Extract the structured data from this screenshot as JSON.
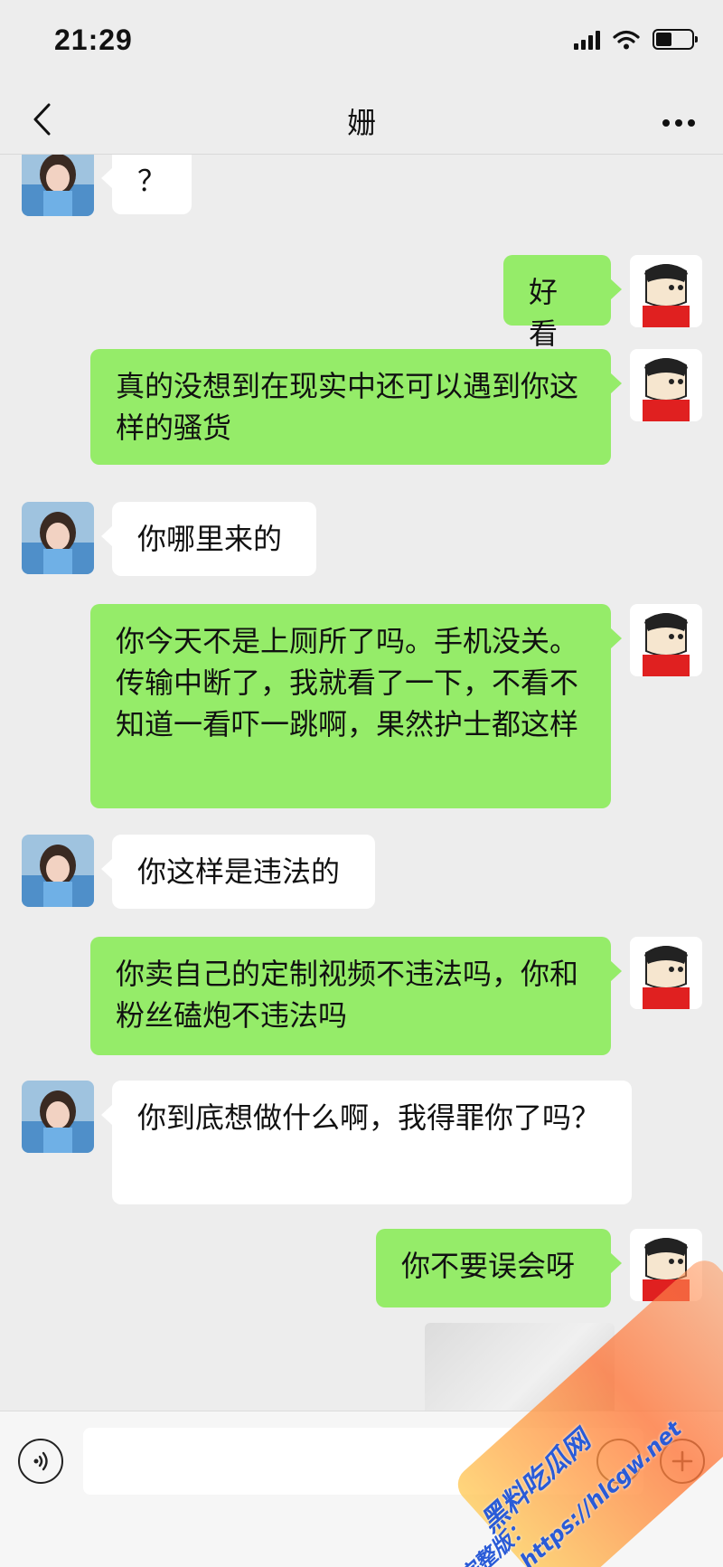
{
  "status_bar": {
    "time": "21:29",
    "battery_level": 0.45
  },
  "nav": {
    "title": "姗"
  },
  "messages": [
    {
      "side": "in",
      "text": "？"
    },
    {
      "side": "out",
      "text": "好看"
    },
    {
      "side": "out",
      "text": "真的没想到在现实中还可以遇到你这样的骚货"
    },
    {
      "side": "in",
      "text": "你哪里来的"
    },
    {
      "side": "out",
      "text": "你今天不是上厕所了吗。手机没关。传输中断了，我就看了一下，不看不知道一看吓一跳啊，果然护士都这样"
    },
    {
      "side": "in",
      "text": "你这样是违法的"
    },
    {
      "side": "out",
      "text": "你卖自己的定制视频不违法吗，你和粉丝磕炮不违法吗"
    },
    {
      "side": "in",
      "text": "你到底想做什么啊，我得罪你了吗？"
    },
    {
      "side": "out",
      "text": "你不要误会呀"
    }
  ],
  "watermark": {
    "line1": "黑料吃瓜网",
    "line2": "https://hlcgw.net",
    "line3": "看完整版："
  },
  "icons": {
    "back": "chevron-left-icon",
    "more": "more-dots-icon",
    "voice": "voice-icon",
    "plus": "plus-icon"
  }
}
